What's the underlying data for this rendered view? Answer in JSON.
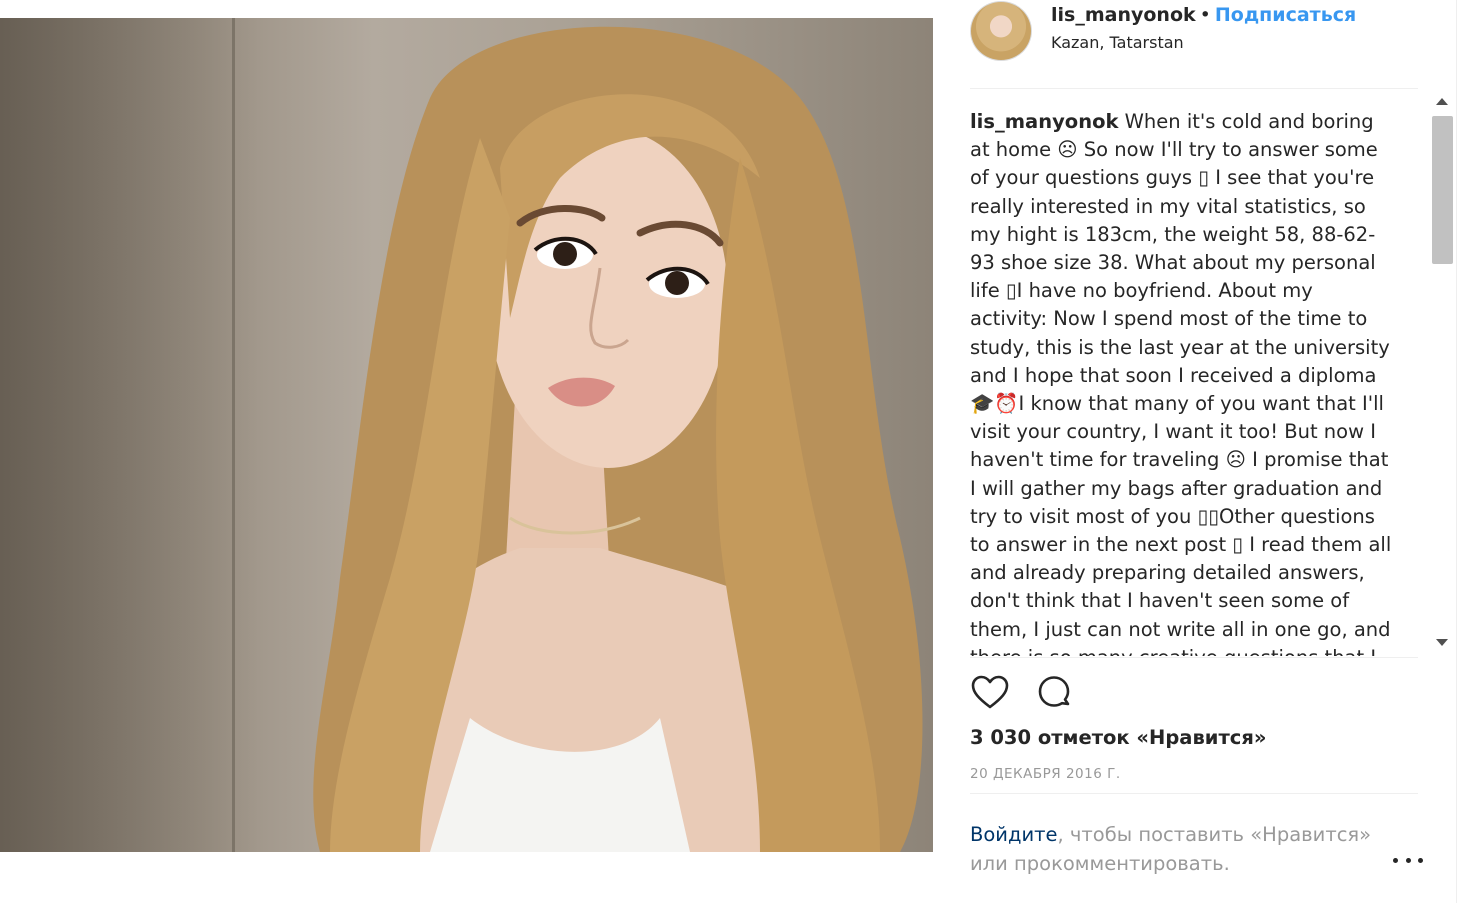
{
  "post": {
    "image_alt": "photo",
    "author": {
      "username": "lis_manyonok",
      "separator": "•",
      "follow_label": "Подписаться",
      "location": "Kazan, Tatarstan"
    },
    "caption": {
      "username": "lis_manyonok",
      "text": " When it's cold and boring at home ☹ So now I'll try to answer some of your questions guys ▯ I see that you're really interested in my vital statistics, so my hight is 183cm, the weight 58, 88-62-93 shoe size 38. What about my personal life ▯I have no boyfriend. About my activity: Now I spend most of the time to study, this is the last year at the university and I hope that soon I received a diploma 🎓⏰I know that many of you want that I'll visit your country, I want it too! But now I haven't time for traveling ☹ I promise that I will gather my bags after graduation and try to visit most of you ▯▯Other questions to answer in the next post ▯ I read them all and already preparing detailed answers, don't think that I haven't seen some of them, I just can not write all in one go, and there is so many creative questions that I"
    },
    "likes_text": "3 030 отметок «Нравится»",
    "date_text": "20 ДЕКАБРЯ 2016 Г.",
    "login_prompt": {
      "link_label": "Войдите",
      "rest": ", чтобы поставить «Нравится» или прокомментировать."
    }
  },
  "icons": {
    "like": "heart-icon",
    "comment": "comment-icon",
    "more": "more-options-icon",
    "scroll_up": "scroll-up-arrow-icon",
    "scroll_down": "scroll-down-arrow-icon"
  },
  "colors": {
    "link_blue": "#3897f0",
    "login_link": "#003569",
    "muted": "#999999",
    "text": "#262626"
  }
}
